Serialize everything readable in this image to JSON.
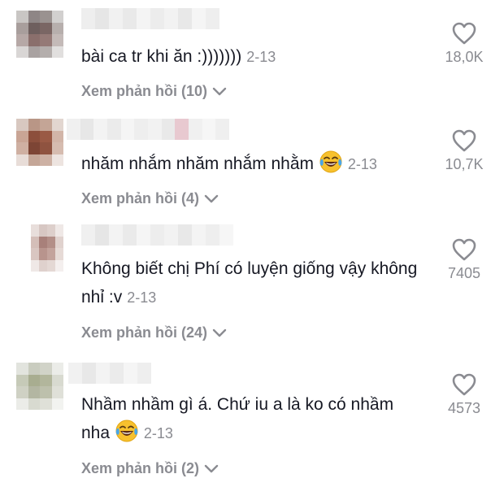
{
  "comments": [
    {
      "text": "bài ca tr khi ăn :)))))))",
      "date": "2-13",
      "replies": "Xem phản hồi (10)",
      "likes": "18,0K"
    },
    {
      "text": "nhăm nhắm nhăm nhắm nhằm",
      "emoji": "laughing-tears-emoji",
      "date": "2-13",
      "replies": "Xem phản hồi (4)",
      "likes": "10,7K"
    },
    {
      "text": "Không biết chị Phí có luyện giống vậy không nhỉ :v",
      "date": "2-13",
      "replies": "Xem phản hồi (24)",
      "likes": "7405"
    },
    {
      "text": "Nhầm nhầm gì á. Chứ iu a là ko có nhầm nha",
      "emoji": "laughing-tears-emoji",
      "date": "2-13",
      "replies": "Xem phản hồi (2)",
      "likes": "4573"
    }
  ],
  "icons": {
    "like": "heart-outline-icon",
    "expand": "chevron-down-icon"
  },
  "colors": {
    "text": "#161823",
    "secondary": "#8a8b91"
  }
}
